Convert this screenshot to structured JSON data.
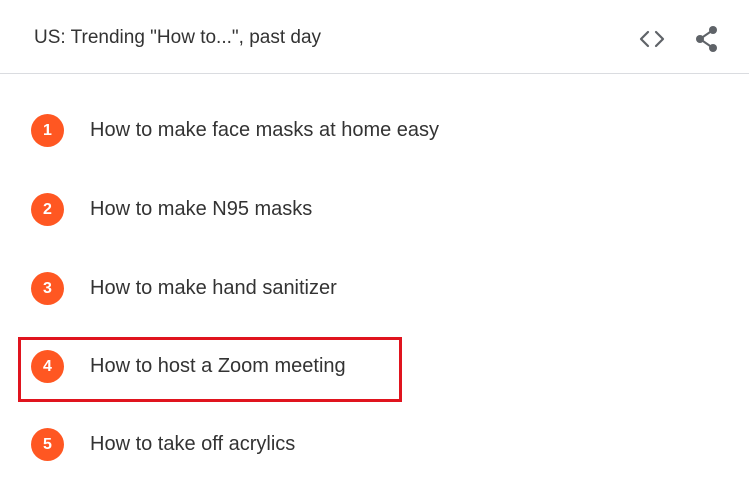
{
  "header": {
    "title": "US: Trending \"How to...\", past day",
    "embed_icon": "embed-code-icon",
    "share_icon": "share-icon"
  },
  "colors": {
    "badge": "#ff5722",
    "highlight": "#e0141e",
    "text": "#333333",
    "divider": "#dadce0"
  },
  "items": [
    {
      "rank": "1",
      "label": "How to make face masks at home easy"
    },
    {
      "rank": "2",
      "label": "How to make N95 masks"
    },
    {
      "rank": "3",
      "label": "How to make hand sanitizer"
    },
    {
      "rank": "4",
      "label": "How to host a Zoom meeting"
    },
    {
      "rank": "5",
      "label": "How to take off acrylics"
    }
  ],
  "highlighted_rank": "4"
}
